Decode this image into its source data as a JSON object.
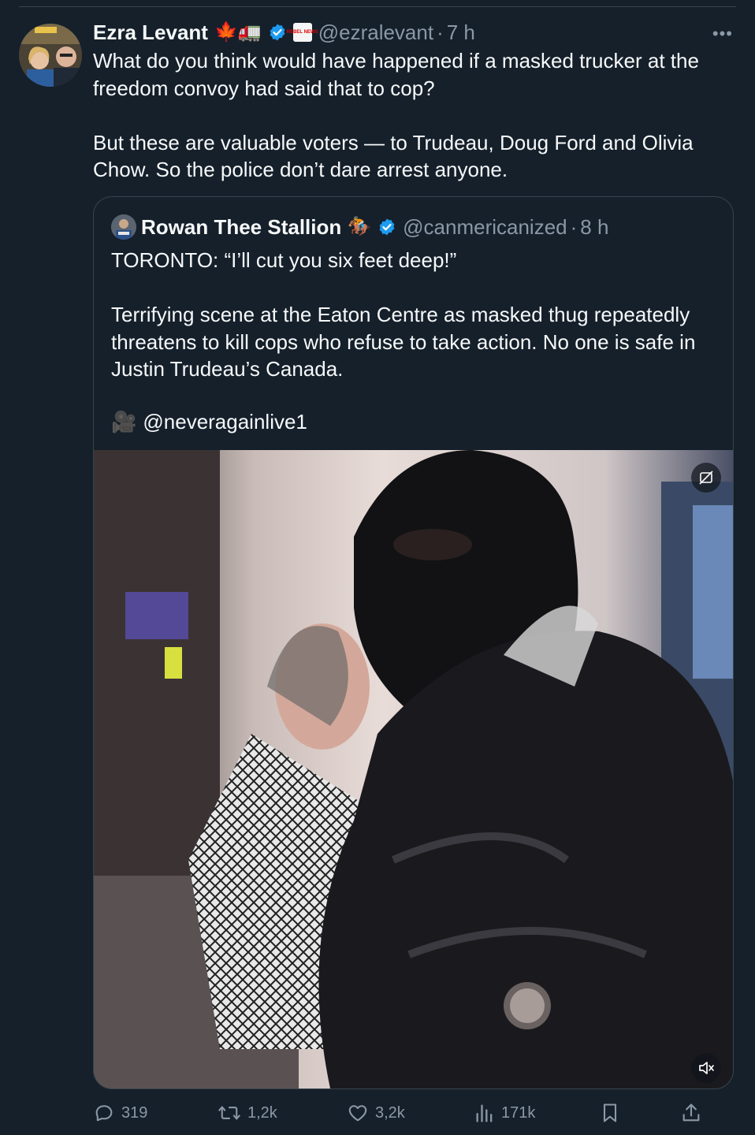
{
  "post": {
    "author_name": "Ezra Levant",
    "author_emojis": "🍁🚛",
    "author_handle": "@ezralevant",
    "separator": "·",
    "time": "7 h",
    "affiliate_badge_text": "REBEL NEWS",
    "more_label": "•••",
    "text": "What do you think would have happened if a masked trucker at the freedom convoy had said that to cop?\n\nBut these are valuable voters — to Trudeau, Doug Ford and Olivia Chow. So the police don’t dare arrest anyone."
  },
  "quoted": {
    "author_name": "Rowan Thee Stallion",
    "author_emoji": "🏇",
    "author_handle": "@canmericanized",
    "separator": "·",
    "time": "8 h",
    "text": "TORONTO: “I’ll cut you six feet deep!”\n\nTerrifying scene at the Eaton Centre as masked thug repeatedly threatens to kill cops who refuse to take action. No one is safe in Justin Trudeau’s Canada.",
    "credit_emoji": "🎥",
    "credit_handle": "@neveragainlive1"
  },
  "video": {
    "controls": [
      "hide-icon",
      "mute-icon"
    ]
  },
  "actions": {
    "replies": "319",
    "reposts": "1,2k",
    "likes": "3,2k",
    "views": "171k"
  },
  "colors": {
    "background": "#15202b",
    "text": "#f7f9f9",
    "muted": "#8b98a5",
    "border": "#38444d",
    "verified": "#1d9bf0"
  }
}
